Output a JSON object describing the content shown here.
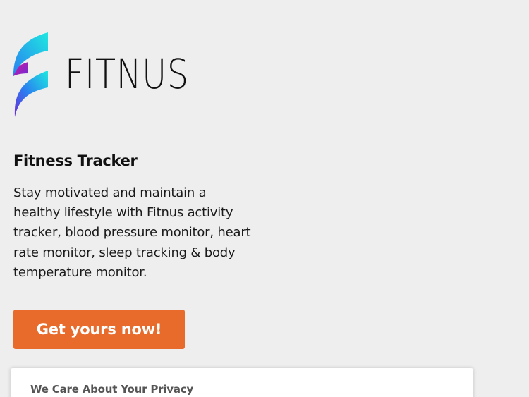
{
  "brand": {
    "name": "FITNUS",
    "colors": {
      "gradient_start": "#1ee8e0",
      "gradient_mid": "#2a7ff0",
      "gradient_accent": "#d6189c",
      "gradient_end": "#6a2bd8"
    }
  },
  "hero": {
    "heading": "Fitness Tracker",
    "description": "Stay motivated and maintain a healthy lifestyle with Fitnus activity tracker, blood pressure monitor, heart rate monitor, sleep tracking & body temperature monitor.",
    "cta_label": "Get yours now!",
    "cta_color": "#e86b2c"
  },
  "privacy": {
    "title": "We Care About Your Privacy"
  }
}
